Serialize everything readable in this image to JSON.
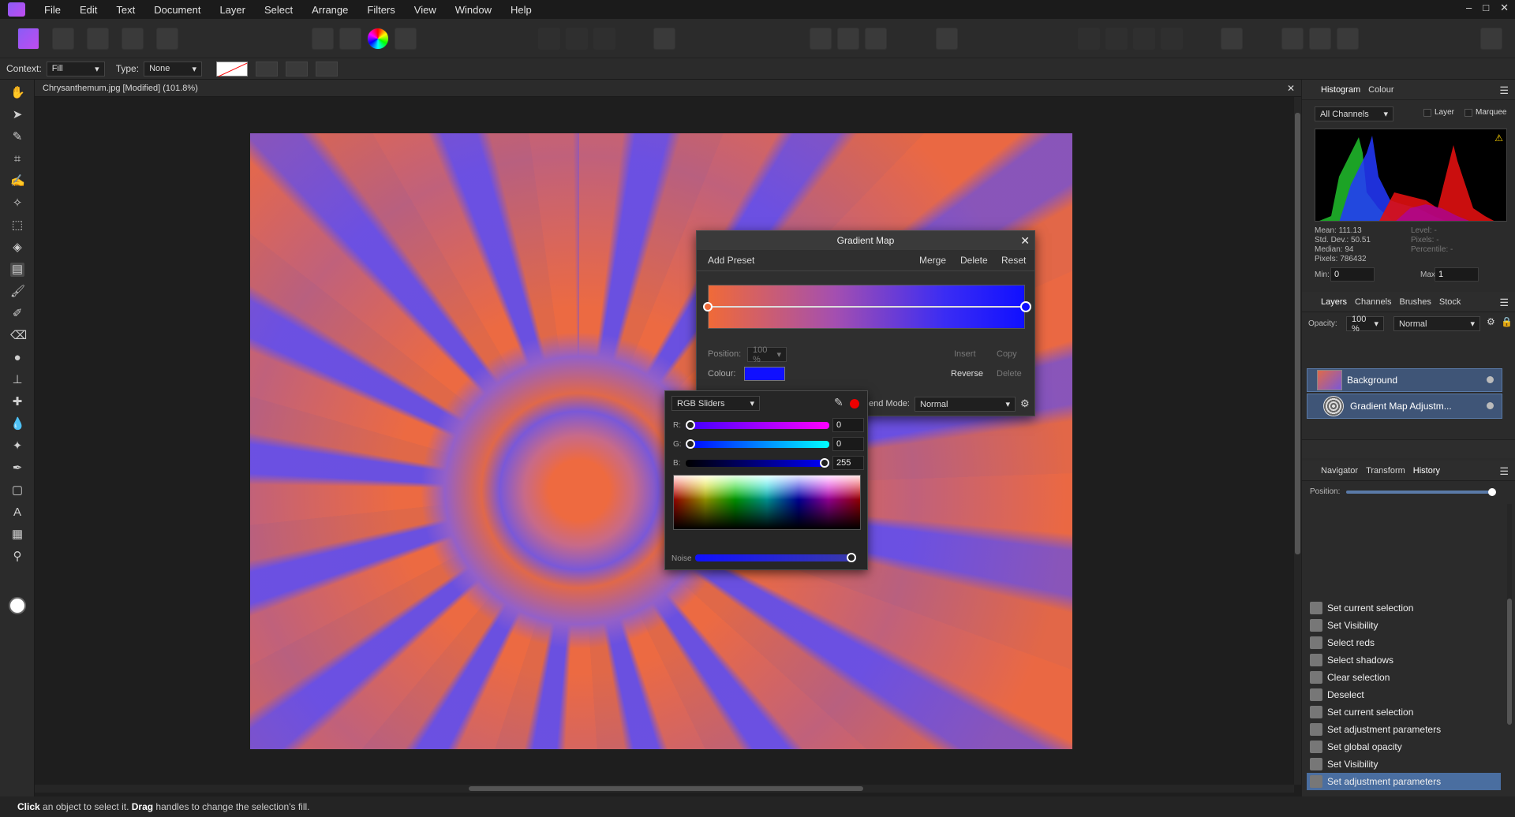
{
  "app": {
    "menu": [
      "File",
      "Edit",
      "Text",
      "Document",
      "Layer",
      "Select",
      "Arrange",
      "Filters",
      "View",
      "Window",
      "Help"
    ],
    "window_controls": [
      "–",
      "□",
      "✕"
    ]
  },
  "context_bar": {
    "context_label": "Context:",
    "context_value": "Fill",
    "type_label": "Type:",
    "type_value": "None"
  },
  "document": {
    "tab_title": "Chrysanthemum.jpg [Modified] (101.8%)",
    "close": "✕"
  },
  "status": {
    "click": "Click",
    "text1": " an object to select it. ",
    "drag": "Drag",
    "text2": " handles to change the selection's fill."
  },
  "gradient_map": {
    "title": "Gradient Map",
    "add_preset": "Add Preset",
    "merge": "Merge",
    "delete": "Delete",
    "reset": "Reset",
    "position_label": "Position:",
    "position_value": "100 %",
    "insert": "Insert",
    "copy": "Copy",
    "colour_label": "Colour:",
    "reverse": "Reverse",
    "delete2": "Delete",
    "blend_mode_label": "end Mode:",
    "blend_mode_value": "Normal",
    "colour_swatch": "#1010ff"
  },
  "rgb_popup": {
    "mode": "RGB Sliders",
    "r_label": "R:",
    "g_label": "G:",
    "b_label": "B:",
    "r_value": "0",
    "g_value": "0",
    "b_value": "255",
    "noise_label": "Noise",
    "r_fraction": 0,
    "g_fraction": 0,
    "b_fraction": 1,
    "noise_fraction": 1
  },
  "histogram_panel": {
    "tabs": [
      "Histogram",
      "Colour"
    ],
    "channels": "All Channels",
    "layer_label": "Layer",
    "marquee_label": "Marquee",
    "mean": "Mean: 111.13",
    "std": "Std. Dev.: 50.51",
    "median": "Median: 94",
    "pixels": "Pixels: 786432",
    "level": "Level: -",
    "pixels2": "Pixels: -",
    "percentile": "Percentile: -",
    "min_label": "Min:",
    "min_value": "0",
    "max_label": "Max:",
    "max_value": "1"
  },
  "layers_panel": {
    "tabs": [
      "Layers",
      "Channels",
      "Brushes",
      "Stock"
    ],
    "opacity_label": "Opacity:",
    "opacity_value": "100 %",
    "blend": "Normal",
    "layers": [
      "Background",
      "Gradient Map Adjustm..."
    ]
  },
  "history_panel": {
    "tabs": [
      "Navigator",
      "Transform",
      "History"
    ],
    "position_label": "Position:",
    "items": [
      "Set current selection",
      "Set Visibility",
      "Select reds",
      "Select shadows",
      "Clear selection",
      "Deselect",
      "Set current selection",
      "Set adjustment parameters",
      "Set global opacity",
      "Set Visibility",
      "Set adjustment parameters"
    ]
  }
}
